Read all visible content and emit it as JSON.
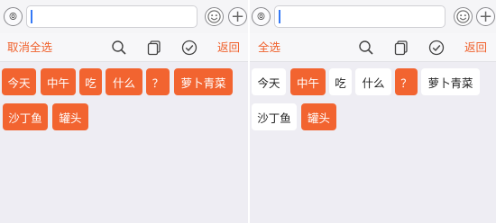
{
  "colors": {
    "accent": "#f26430",
    "chip_selected_text": "#ffffff",
    "chip_unselected_bg": "#ffffff",
    "cursor": "#3478f6",
    "background": "#eeedf3"
  },
  "left_panel": {
    "toolbar": {
      "left_action": "取消全选",
      "right_action": "返回",
      "icons": [
        "search-icon",
        "copy-icon",
        "check-circle-icon"
      ]
    },
    "chips": [
      {
        "text": "今天",
        "selected": true
      },
      {
        "text": "中午",
        "selected": true
      },
      {
        "text": "吃",
        "selected": true
      },
      {
        "text": "什么",
        "selected": true
      },
      {
        "text": "？",
        "selected": true
      },
      {
        "text": "萝卜青菜",
        "selected": true
      },
      {
        "text": "沙丁鱼",
        "selected": true
      },
      {
        "text": "罐头",
        "selected": true
      }
    ]
  },
  "right_panel": {
    "toolbar": {
      "left_action": "全选",
      "right_action": "返回",
      "icons": [
        "search-icon",
        "copy-icon",
        "check-circle-icon"
      ]
    },
    "chips": [
      {
        "text": "今天",
        "selected": false
      },
      {
        "text": "中午",
        "selected": true
      },
      {
        "text": "吃",
        "selected": false
      },
      {
        "text": "什么",
        "selected": false
      },
      {
        "text": "？",
        "selected": true
      },
      {
        "text": "萝卜青菜",
        "selected": false
      },
      {
        "text": "沙丁鱼",
        "selected": false
      },
      {
        "text": "罐头",
        "selected": true
      }
    ]
  }
}
